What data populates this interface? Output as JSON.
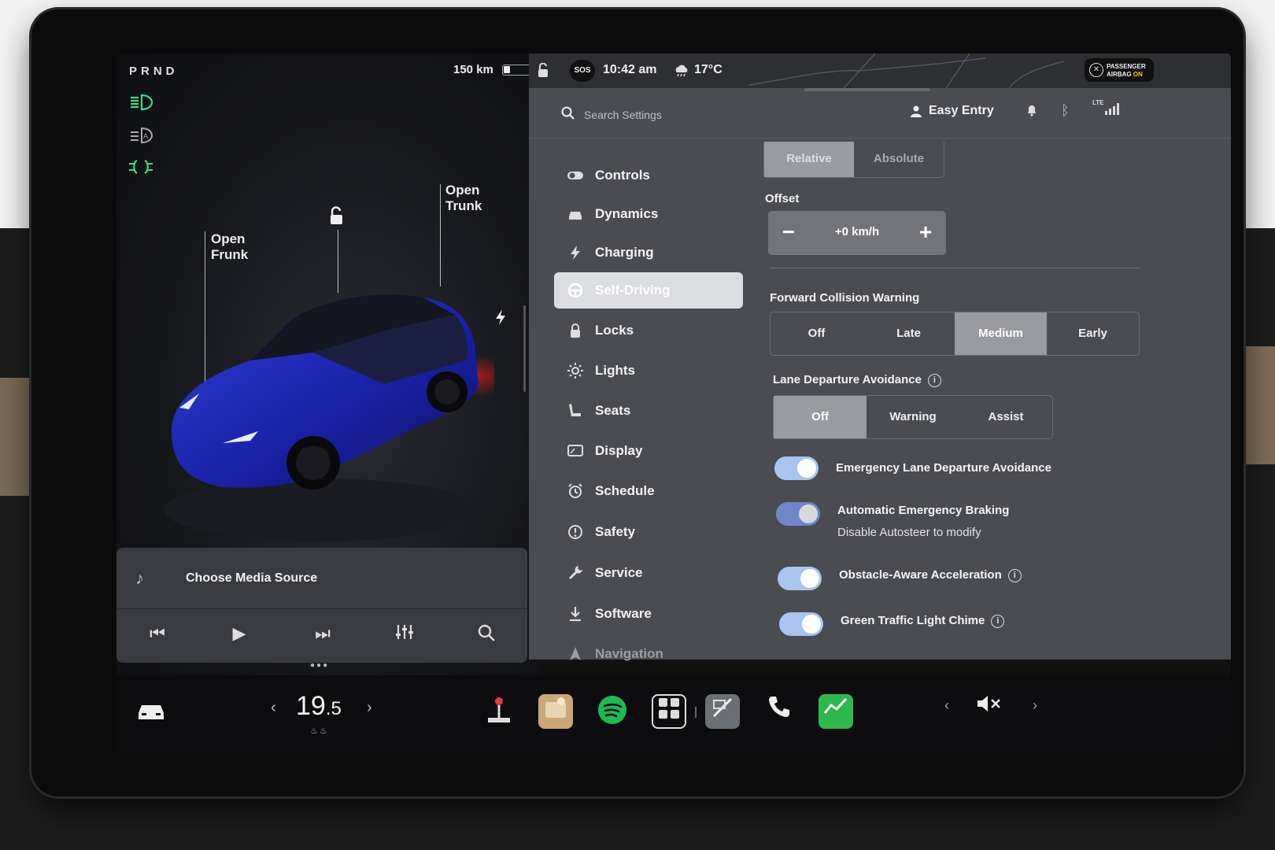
{
  "drive": {
    "gears": "PRND",
    "range": "150 km"
  },
  "status": {
    "sos": "SOS",
    "time": "10:42 am",
    "temperature": "17°C",
    "airbag_line1": "PASSENGER",
    "airbag_line2": "AIRBAG",
    "airbag_state": "ON"
  },
  "car_view": {
    "open_frunk": "Open\nFrunk",
    "open_trunk": "Open\nTrunk"
  },
  "media": {
    "title": "Choose Media Source"
  },
  "search": {
    "placeholder": "Search Settings"
  },
  "profile": {
    "name": "Easy Entry"
  },
  "signal": {
    "label": "LTE"
  },
  "nav": {
    "items": [
      {
        "label": "Controls",
        "icon": "toggle-icon"
      },
      {
        "label": "Dynamics",
        "icon": "car-icon"
      },
      {
        "label": "Charging",
        "icon": "bolt-icon"
      },
      {
        "label": "Self-Driving",
        "icon": "steering-wheel-icon",
        "active": true
      },
      {
        "label": "Locks",
        "icon": "lock-icon"
      },
      {
        "label": "Lights",
        "icon": "sun-icon"
      },
      {
        "label": "Seats",
        "icon": "seat-icon"
      },
      {
        "label": "Display",
        "icon": "display-icon"
      },
      {
        "label": "Schedule",
        "icon": "alarm-icon"
      },
      {
        "label": "Safety",
        "icon": "alert-icon"
      },
      {
        "label": "Service",
        "icon": "wrench-icon"
      },
      {
        "label": "Software",
        "icon": "download-icon"
      },
      {
        "label": "Navigation",
        "icon": "navigation-icon"
      }
    ]
  },
  "settings": {
    "speed_mode": {
      "options": [
        "Relative",
        "Absolute"
      ],
      "selected": "Relative"
    },
    "offset": {
      "label": "Offset",
      "value": "+0 km/h",
      "minus": "−",
      "plus": "+"
    },
    "fcw": {
      "label": "Forward Collision Warning",
      "options": [
        "Off",
        "Late",
        "Medium",
        "Early"
      ],
      "selected": "Medium"
    },
    "lda": {
      "label": "Lane Departure Avoidance",
      "options": [
        "Off",
        "Warning",
        "Assist"
      ],
      "selected": "Off"
    },
    "toggles": [
      {
        "label": "Emergency Lane Departure Avoidance",
        "on": true
      },
      {
        "label": "Automatic Emergency Braking",
        "sub": "Disable Autosteer to modify",
        "on": true
      },
      {
        "label": "Obstacle-Aware Acceleration",
        "on": true,
        "info": true
      },
      {
        "label": "Green Traffic Light Chime",
        "on": true,
        "info": true
      }
    ]
  },
  "climate": {
    "temp_main": "19",
    "temp_decimal": ".5"
  },
  "colors": {
    "accent_green": "#3ddc84",
    "toggle_blue": "#a9c4ee",
    "panel": "#4b4c52",
    "spotify": "#1db954"
  }
}
